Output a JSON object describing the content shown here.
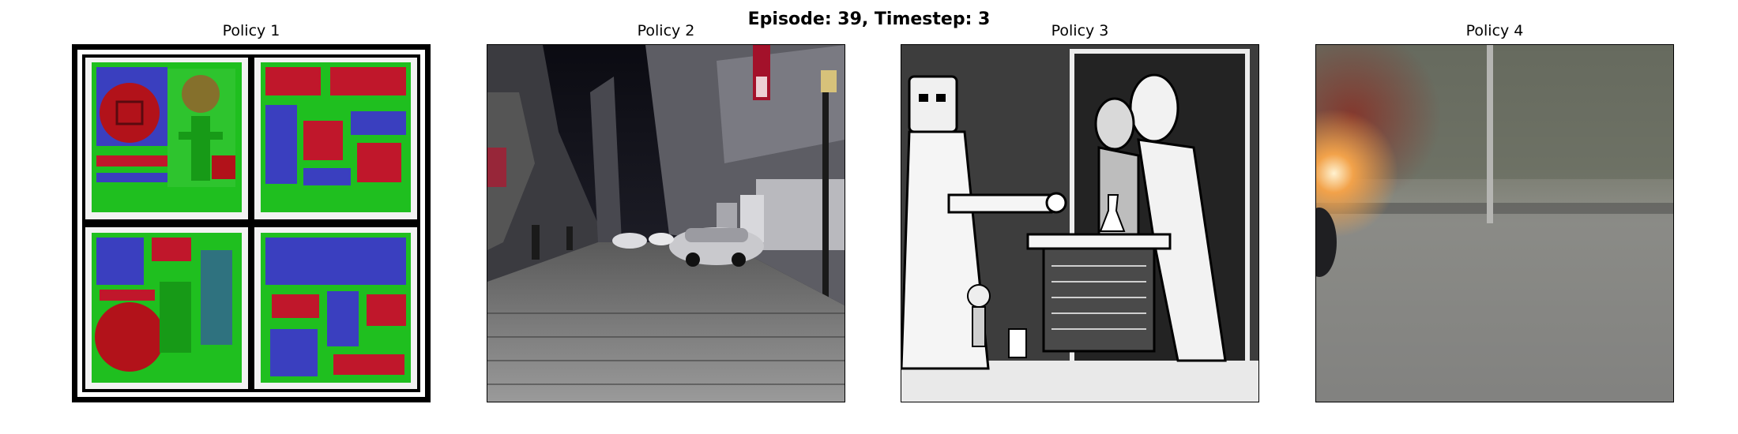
{
  "figure": {
    "suptitle": "Episode: 39, Timestep: 3"
  },
  "panels": [
    {
      "title": "Policy 1",
      "image_subject": "four-tile pixel-art mosaic in green, red and blue"
    },
    {
      "title": "Policy 2",
      "image_subject": "night city street with parked cars"
    },
    {
      "title": "Policy 3",
      "image_subject": "black and white cartoon of figures around a table"
    },
    {
      "title": "Policy 4",
      "image_subject": "blurry roadside with pole and orange light flare"
    }
  ]
}
